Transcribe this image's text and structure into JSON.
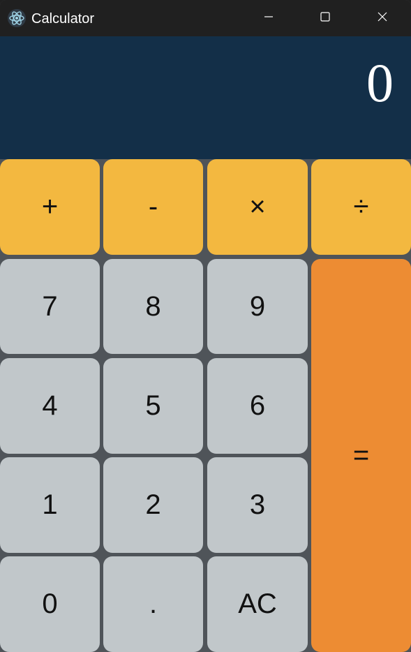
{
  "window": {
    "title": "Calculator",
    "icon": "electron-atom-icon"
  },
  "window_controls": {
    "minimize_icon": "minimize-icon",
    "maximize_icon": "maximize-icon",
    "close_icon": "close-icon"
  },
  "display": {
    "value": "0"
  },
  "keys": {
    "add": "+",
    "subtract": "-",
    "multiply": "×",
    "divide": "÷",
    "seven": "7",
    "eight": "8",
    "nine": "9",
    "four": "4",
    "five": "5",
    "six": "6",
    "one": "1",
    "two": "2",
    "three": "3",
    "zero": "0",
    "decimal": ".",
    "clear": "AC",
    "equals": "="
  },
  "colors": {
    "titlebar": "#202020",
    "display_background": "#132f48",
    "grid_background": "#4f5459",
    "operator_key": "#f3b840",
    "number_key": "#c1c7ca",
    "equals_key": "#ed8c33"
  }
}
